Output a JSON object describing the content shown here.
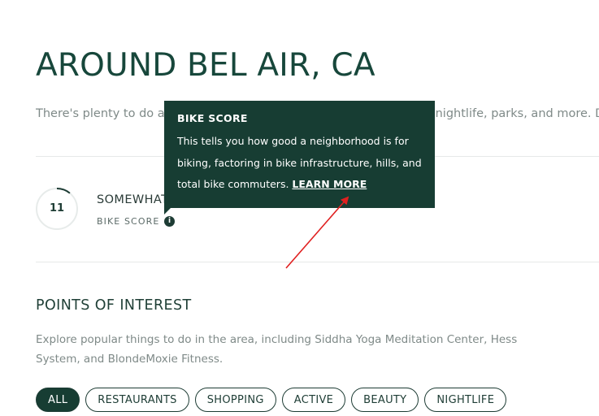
{
  "page": {
    "title": "AROUND BEL AIR, CA",
    "intro": "There's plenty to do around Bel Air, CA, including shopping, dining, nightlife, parks, and more. D"
  },
  "score": {
    "value": "11",
    "level": 0.11,
    "label": "SOMEWHAT BIKEABLE",
    "name": "BIKE SCORE",
    "info_icon": "info-icon"
  },
  "tooltip": {
    "title": "BIKE SCORE",
    "body": "This tells you how good a neighborhood is for biking, factoring in bike infrastructure, hills, and total bike commuters.",
    "link": "LEARN MORE"
  },
  "poi": {
    "title": "POINTS OF INTEREST",
    "description": "Explore popular things to do in the area, including Siddha Yoga Meditation Center, Hess System, and BlondeMoxie Fitness.",
    "filters": [
      {
        "label": "ALL",
        "active": true
      },
      {
        "label": "RESTAURANTS",
        "active": false
      },
      {
        "label": "SHOPPING",
        "active": false
      },
      {
        "label": "ACTIVE",
        "active": false
      },
      {
        "label": "BEAUTY",
        "active": false
      },
      {
        "label": "NIGHTLIFE",
        "active": false
      }
    ]
  },
  "colors": {
    "brand_dark": "#173d33",
    "annotation_arrow": "#e02020",
    "muted_text": "#7f8a88"
  }
}
